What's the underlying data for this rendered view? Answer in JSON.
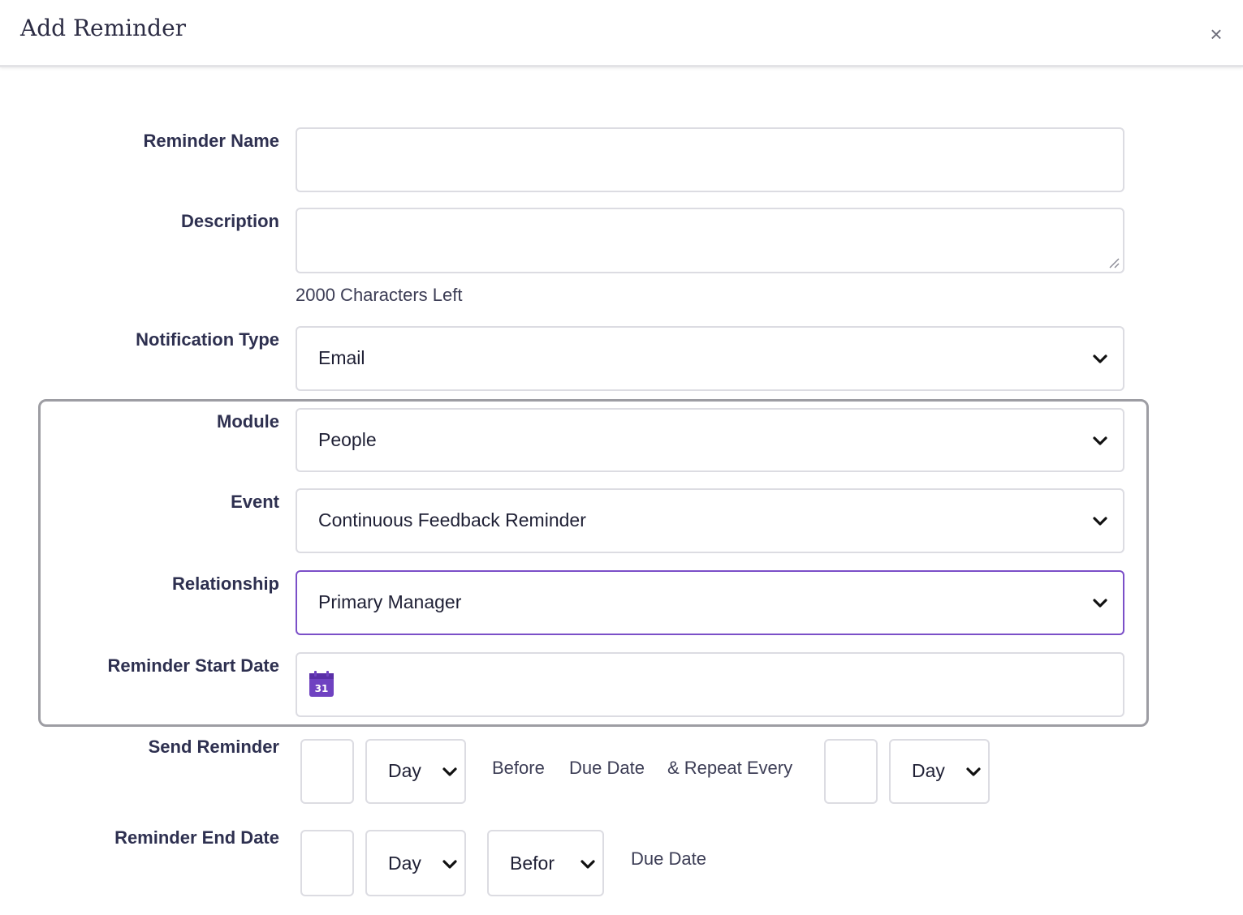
{
  "dialog": {
    "title": "Add Reminder",
    "close_glyph": "×"
  },
  "form": {
    "reminder_name": {
      "label": "Reminder Name",
      "value": ""
    },
    "description": {
      "label": "Description",
      "value": "",
      "counter": "2000 Characters Left"
    },
    "notification_type": {
      "label": "Notification Type",
      "selected": "Email"
    },
    "module": {
      "label": "Module",
      "selected": "People"
    },
    "event": {
      "label": "Event",
      "selected": "Continuous Feedback Reminder"
    },
    "relationship": {
      "label": "Relationship",
      "selected": "Primary Manager"
    },
    "reminder_start_date": {
      "label": "Reminder Start Date",
      "value": "",
      "calendar_icon_text": "31"
    },
    "send_reminder": {
      "label": "Send Reminder",
      "count": "",
      "unit": "Day",
      "before_text": "Before",
      "due_date_text": "Due Date",
      "repeat_text": "& Repeat Every",
      "repeat_count": "",
      "repeat_unit": "Day"
    },
    "reminder_end_date": {
      "label": "Reminder End Date",
      "count": "",
      "unit": "Day",
      "direction": "Befor",
      "due_date_text": "Due Date"
    }
  },
  "icons": {
    "chevron": "chevron-down-icon",
    "calendar": "calendar-icon",
    "close": "close-icon",
    "resize": "resize-handle-icon"
  },
  "colors": {
    "accent_purple": "#7b4fc8",
    "calendar_purple": "#6f42c1",
    "text_dark": "#2e3050",
    "border": "#dcdce2",
    "group_border": "#9d9da3"
  }
}
